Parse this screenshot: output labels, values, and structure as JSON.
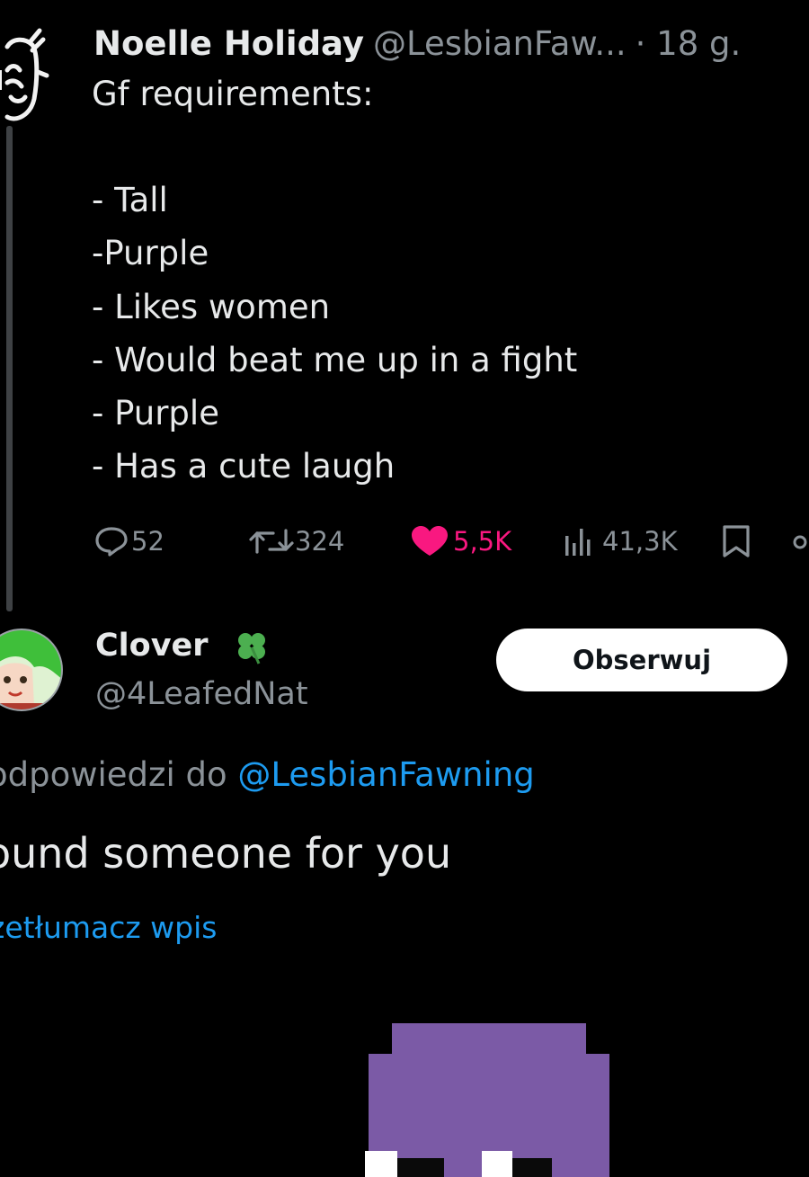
{
  "tweet1": {
    "name": "Noelle Holiday",
    "handle": "@LesbianFaw...",
    "time": "· 18 g.",
    "lines": [
      "Gf requirements:",
      "- Tall",
      "-Purple",
      "- Likes women",
      "- Would beat me up in a fight",
      "- Purple",
      "- Has a cute laugh"
    ],
    "stats": {
      "replies": "52",
      "reposts": "324",
      "likes": "5,5K",
      "views": "41,3K"
    }
  },
  "tweet2": {
    "name": "Clover",
    "handle": "@4LeafedNat",
    "follow_label": "Obserwuj",
    "reply_prefix": "odpowiedzi do ",
    "reply_mention": "@LesbianFawning",
    "text": "ound someone for you",
    "translate": "zetłumacz wpis"
  },
  "colors": {
    "background": "#000000",
    "text": "#e7e9ea",
    "secondary": "#8b9298",
    "link": "#1d9bf0",
    "like": "#f91880",
    "purple": "#7b5aa6"
  },
  "icons": {
    "reply": "reply-icon",
    "repost": "repost-icon",
    "like": "heart-icon",
    "views": "views-icon",
    "bookmark": "bookmark-icon",
    "share": "share-icon",
    "clover": "clover-icon"
  }
}
